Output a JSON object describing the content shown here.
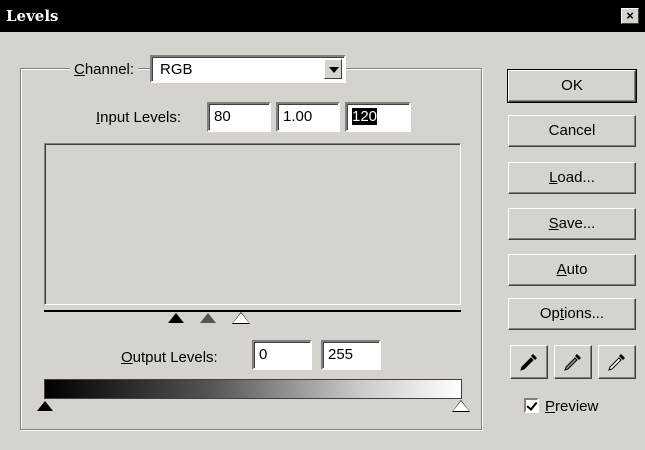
{
  "window": {
    "title": "Levels",
    "close_label": "×"
  },
  "channel": {
    "label_access": "C",
    "label_rest": "hannel:",
    "value": "RGB"
  },
  "input_levels": {
    "label_access": "I",
    "label_rest": "nput Levels:",
    "black": "80",
    "gamma": "1.00",
    "white": "120"
  },
  "output_levels": {
    "label_access": "O",
    "label_rest": "utput Levels:",
    "black": "0",
    "white": "255"
  },
  "buttons": {
    "ok": "OK",
    "cancel": "Cancel",
    "load_access": "L",
    "load_rest": "oad...",
    "save_access": "S",
    "save_rest": "ave...",
    "auto_access": "A",
    "auto_rest": "uto",
    "options_pre": "Op",
    "options_access": "t",
    "options_post": "ions..."
  },
  "eyedroppers": [
    "black-eyedropper-icon",
    "gray-eyedropper-icon",
    "white-eyedropper-icon"
  ],
  "preview": {
    "label_access": "P",
    "label_rest": "review",
    "checked": true
  },
  "colors": {
    "title_bar": "#000000",
    "dialog_bg": "#d6d3ce"
  }
}
